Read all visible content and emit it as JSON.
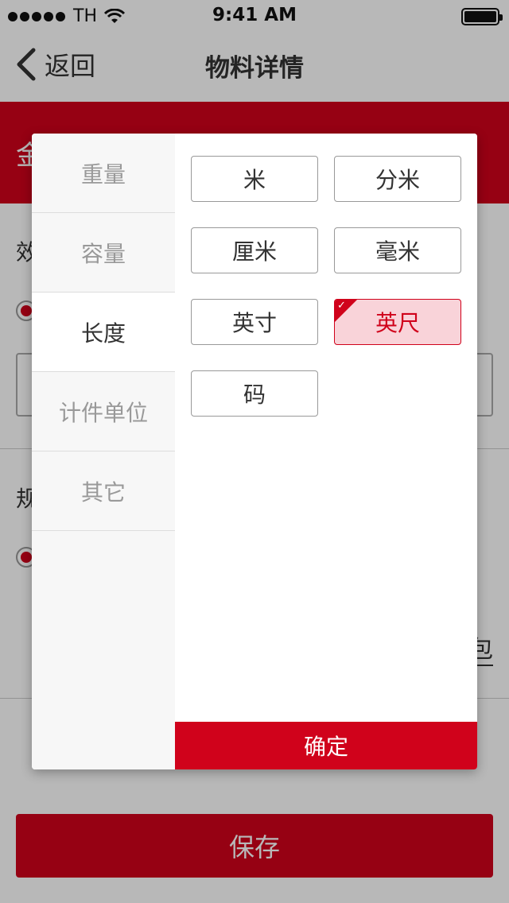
{
  "status_bar": {
    "carrier": "TH",
    "time": "9:41 AM"
  },
  "nav": {
    "back_label": "返回",
    "title": "物料详情"
  },
  "background": {
    "banner_text": "金",
    "section1_label": "效",
    "section2_label": "规",
    "trailing_text": "包",
    "save_label": "保存"
  },
  "modal": {
    "categories": [
      {
        "label": "重量"
      },
      {
        "label": "容量"
      },
      {
        "label": "长度"
      },
      {
        "label": "计件单位"
      },
      {
        "label": "其它"
      }
    ],
    "active_category": "长度",
    "units": [
      {
        "label": "米"
      },
      {
        "label": "分米"
      },
      {
        "label": "厘米"
      },
      {
        "label": "毫米"
      },
      {
        "label": "英寸"
      },
      {
        "label": "英尺"
      },
      {
        "label": "码"
      }
    ],
    "selected_unit": "英尺",
    "confirm_label": "确定"
  },
  "colors": {
    "accent": "#d0021b",
    "selected_bg": "#f9d3d9"
  },
  "icons": [
    "back-chevron-icon",
    "wifi-icon",
    "battery-icon",
    "check-icon"
  ]
}
